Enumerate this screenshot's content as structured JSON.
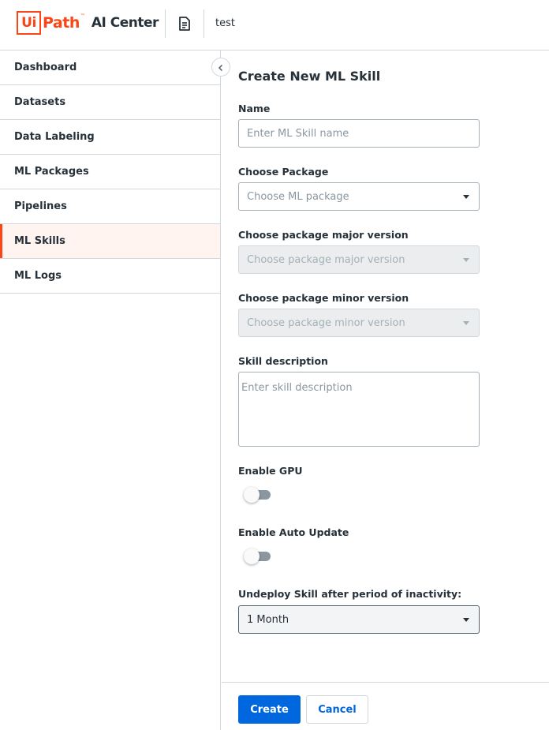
{
  "header": {
    "logo_ui": "Ui",
    "logo_path": "Path",
    "logo_tm": "™",
    "product_name": "AI Center",
    "project_name": "test"
  },
  "sidebar": {
    "items": [
      {
        "label": "Dashboard",
        "active": false
      },
      {
        "label": "Datasets",
        "active": false
      },
      {
        "label": "Data Labeling",
        "active": false
      },
      {
        "label": "ML Packages",
        "active": false
      },
      {
        "label": "Pipelines",
        "active": false
      },
      {
        "label": "ML Skills",
        "active": true
      },
      {
        "label": "ML Logs",
        "active": false
      }
    ]
  },
  "form": {
    "title": "Create New ML Skill",
    "name": {
      "label": "Name",
      "placeholder": "Enter ML Skill name",
      "value": ""
    },
    "package": {
      "label": "Choose Package",
      "placeholder": "Choose ML package"
    },
    "major_version": {
      "label": "Choose package major version",
      "placeholder": "Choose package major version",
      "disabled": true
    },
    "minor_version": {
      "label": "Choose package minor version",
      "placeholder": "Choose package minor version",
      "disabled": true
    },
    "description": {
      "label": "Skill description",
      "placeholder": "Enter skill description",
      "value": ""
    },
    "enable_gpu": {
      "label": "Enable GPU",
      "checked": false
    },
    "enable_auto_update": {
      "label": "Enable Auto Update",
      "checked": false
    },
    "undeploy": {
      "label": "Undeploy Skill after period of inactivity:",
      "value": "1 Month"
    }
  },
  "footer": {
    "create_label": "Create",
    "cancel_label": "Cancel"
  },
  "colors": {
    "brand": "#fa4616",
    "primary": "#0067df",
    "text": "#273139",
    "border": "#cfd8dd"
  },
  "icons": {
    "project": "document-icon",
    "collapse": "chevron-left-icon",
    "dropdown": "caret-down-icon"
  }
}
